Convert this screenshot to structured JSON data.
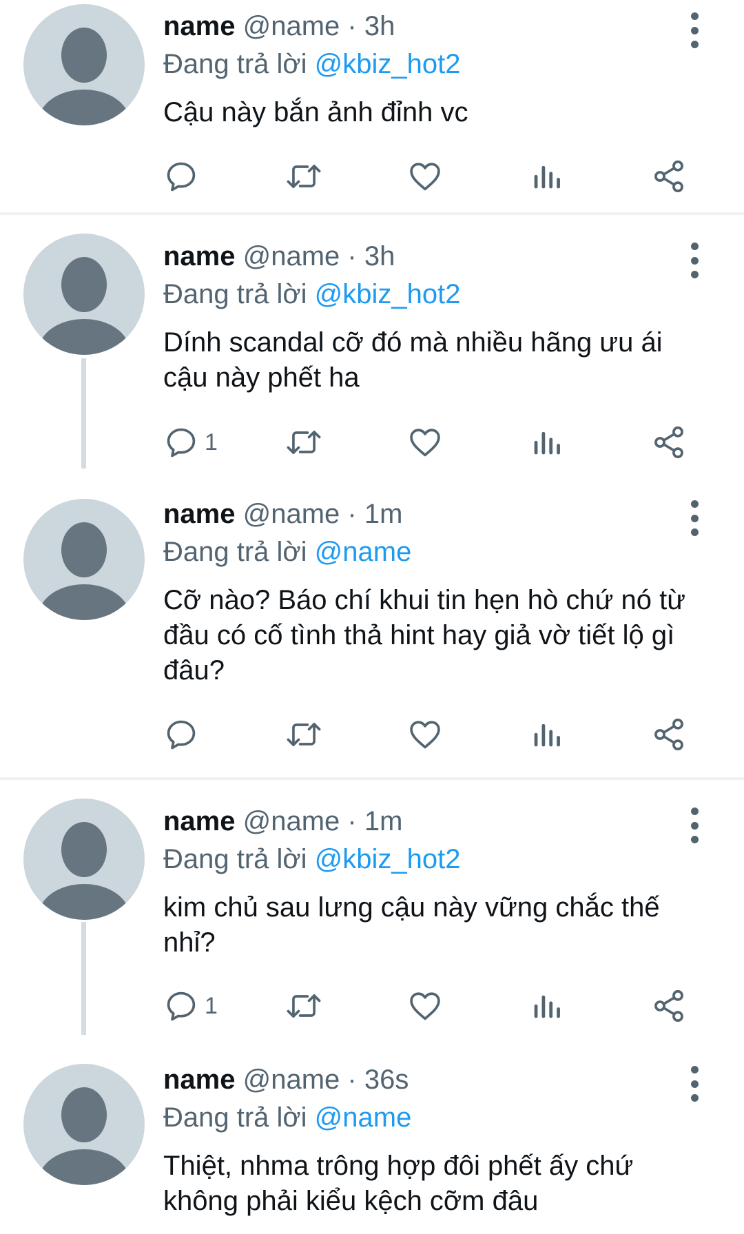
{
  "tweets": [
    {
      "display_name": "name",
      "handle": "@name",
      "time": "3h",
      "reply_prefix": "Đang trả lời",
      "reply_to": "@kbiz_hot2",
      "text": "Cậu này bắn ảnh đỉnh vc",
      "reply_count": ""
    },
    {
      "display_name": "name",
      "handle": "@name",
      "time": "3h",
      "reply_prefix": "Đang trả lời",
      "reply_to": "@kbiz_hot2",
      "text": "Dính scandal cỡ đó mà nhiều hãng ưu ái cậu này phết ha",
      "reply_count": "1"
    },
    {
      "display_name": "name",
      "handle": "@name",
      "time": "1m",
      "reply_prefix": "Đang trả lời",
      "reply_to": "@name",
      "text": "Cỡ nào? Báo chí khui tin hẹn hò chứ nó từ đầu có cố tình thả hint hay giả vờ tiết lộ gì đâu?",
      "reply_count": ""
    },
    {
      "display_name": "name",
      "handle": "@name",
      "time": "1m",
      "reply_prefix": "Đang trả lời",
      "reply_to": "@kbiz_hot2",
      "text": "kim chủ sau lưng cậu này vững chắc thế nhỉ?",
      "reply_count": "1"
    },
    {
      "display_name": "name",
      "handle": "@name",
      "time": "36s",
      "reply_prefix": "Đang trả lời",
      "reply_to": "@name",
      "text": "Thiệt, nhma trông hợp đôi phết ấy chứ không phải kiểu kệch cỡm đâu",
      "reply_count": ""
    }
  ],
  "separator": "·",
  "icons": {
    "reply": "reply-icon",
    "retweet": "retweet-icon",
    "like": "heart-icon",
    "views": "analytics-icon",
    "share": "share-icon",
    "more": "more-vertical-icon",
    "avatar": "default-avatar-icon"
  },
  "colors": {
    "accent": "#1d9bf0",
    "secondary_text": "#536471",
    "avatar_bg": "#ccd6dd",
    "avatar_fg": "#66757f"
  }
}
